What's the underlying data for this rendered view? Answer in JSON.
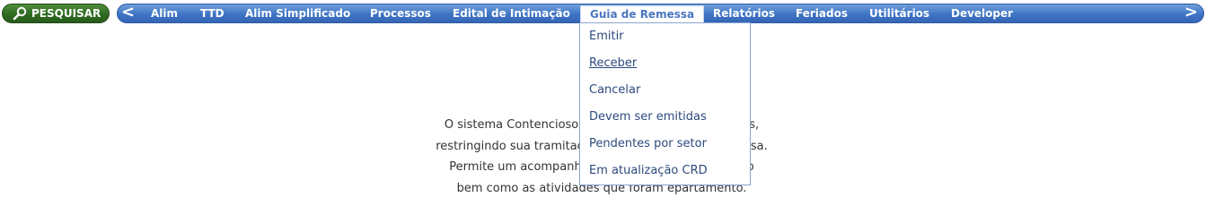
{
  "search": {
    "label": "PESQUISAR",
    "icon": "magnifier-icon"
  },
  "navbar": {
    "prev_arrow": "<",
    "next_arrow": ">",
    "items": [
      {
        "label": "Alim"
      },
      {
        "label": "TTD"
      },
      {
        "label": "Alim Simplificado"
      },
      {
        "label": "Processos"
      },
      {
        "label": "Edital de Intimação"
      },
      {
        "label": "Guia de Remessa",
        "active": true
      },
      {
        "label": "Relatórios"
      },
      {
        "label": "Feriados"
      },
      {
        "label": "Utilitários"
      },
      {
        "label": "Developer"
      }
    ]
  },
  "dropdown": {
    "items": [
      {
        "label": "Emitir"
      },
      {
        "label": "Receber",
        "hovered": true
      },
      {
        "label": "Cancelar"
      },
      {
        "label": "Devem ser emitidas"
      },
      {
        "label": "Pendentes por setor"
      },
      {
        "label": "Em atualização CRD"
      }
    ]
  },
  "description": {
    "lines": [
      "O sistema Contencioso tem por finalic                              ões tributárias,",
      "restringindo sua tramitação inadequad                              guia de remessa.",
      "Permite um acompanhamento do pro                              sua conclusão",
      "bem como as atividades que foram                              epartamento."
    ]
  },
  "colors": {
    "search_green": "#2f6a22",
    "nav_blue": "#3f74c4",
    "active_text": "#4a77c0",
    "dropdown_text": "#2c4a7e"
  }
}
